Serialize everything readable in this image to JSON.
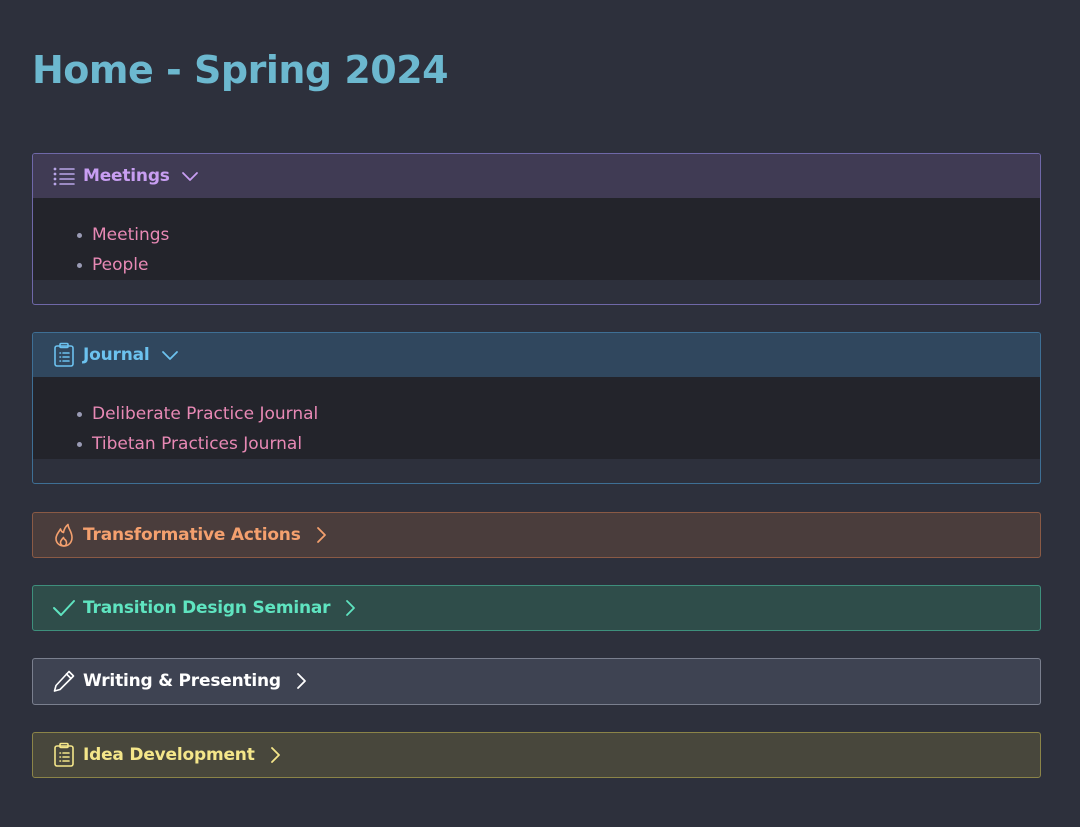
{
  "page": {
    "title": "Home - Spring 2024"
  },
  "callouts": {
    "meetings": {
      "title": "Meetings",
      "icon": "list-icon",
      "chevron": "chevron-down-icon",
      "expanded": true,
      "color": "#c89ef2",
      "items": [
        "Meetings",
        "People"
      ]
    },
    "journal": {
      "title": "Journal",
      "icon": "clipboard-list-icon",
      "chevron": "chevron-down-icon",
      "expanded": true,
      "color": "#6cc2ef",
      "items": [
        "Deliberate Practice Journal",
        "Tibetan Practices Journal"
      ]
    },
    "transformative": {
      "title": "Transformative Actions",
      "icon": "flame-icon",
      "chevron": "chevron-right-icon",
      "expanded": false,
      "color": "#f4a06e"
    },
    "transition": {
      "title": "Transition Design Seminar",
      "icon": "check-icon",
      "chevron": "chevron-right-icon",
      "expanded": false,
      "color": "#5fe4c0"
    },
    "writing": {
      "title": "Writing & Presenting",
      "icon": "pencil-icon",
      "chevron": "chevron-right-icon",
      "expanded": false,
      "color": "#ffffff"
    },
    "idea": {
      "title": "Idea Development",
      "icon": "clipboard-list-icon",
      "chevron": "chevron-right-icon",
      "expanded": false,
      "color": "#f4e68a"
    }
  }
}
